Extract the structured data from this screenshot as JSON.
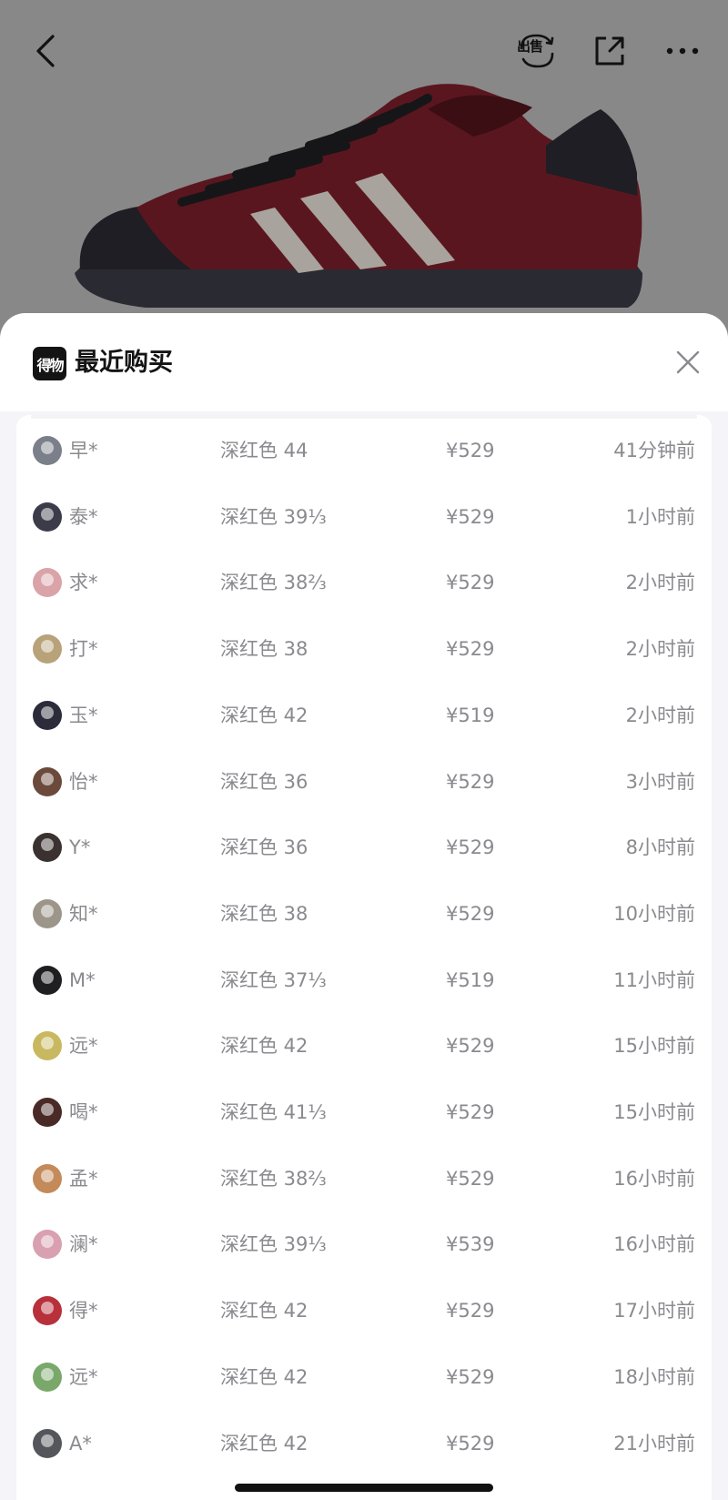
{
  "nav": {
    "back_icon": "chevron-left-icon",
    "sell_label": "出售",
    "share_icon": "share-out-icon",
    "more_icon": "more-horizontal-icon"
  },
  "sheet": {
    "logo_text": "得物",
    "title": "最近购买",
    "close_icon": "close-icon"
  },
  "colors": {
    "overlay_grey": "#888888",
    "shoe_burgundy": "#5a161f",
    "text_primary": "#141414",
    "text_secondary": "#8a8a8f",
    "sheet_background": "#f4f4f9"
  },
  "purchases": [
    {
      "name": "早*",
      "spec": "深红色 44",
      "price": "¥529",
      "time": "41分钟前",
      "avatar_color": "#7a7f8a"
    },
    {
      "name": "泰*",
      "spec": "深红色 39⅓",
      "price": "¥529",
      "time": "1小时前",
      "avatar_color": "#3b3b4a"
    },
    {
      "name": "求*",
      "spec": "深红色 38⅔",
      "price": "¥529",
      "time": "2小时前",
      "avatar_color": "#d9a3a8"
    },
    {
      "name": "打*",
      "spec": "深红色 38",
      "price": "¥529",
      "time": "2小时前",
      "avatar_color": "#b8a27a"
    },
    {
      "name": "玉*",
      "spec": "深红色 42",
      "price": "¥519",
      "time": "2小时前",
      "avatar_color": "#2b2b3a"
    },
    {
      "name": "怡*",
      "spec": "深红色 36",
      "price": "¥529",
      "time": "3小时前",
      "avatar_color": "#6b4a3c"
    },
    {
      "name": "Y*",
      "spec": "深红色 36",
      "price": "¥529",
      "time": "8小时前",
      "avatar_color": "#3a3230"
    },
    {
      "name": "知*",
      "spec": "深红色 38",
      "price": "¥529",
      "time": "10小时前",
      "avatar_color": "#9c968a"
    },
    {
      "name": "M*",
      "spec": "深红色 37⅓",
      "price": "¥519",
      "time": "11小时前",
      "avatar_color": "#1f1f22"
    },
    {
      "name": "远*",
      "spec": "深红色 42",
      "price": "¥529",
      "time": "15小时前",
      "avatar_color": "#c8b860"
    },
    {
      "name": "喝*",
      "spec": "深红色 41⅓",
      "price": "¥529",
      "time": "15小时前",
      "avatar_color": "#4a2a26"
    },
    {
      "name": "孟*",
      "spec": "深红色 38⅔",
      "price": "¥529",
      "time": "16小时前",
      "avatar_color": "#c48a5a"
    },
    {
      "name": "澜*",
      "spec": "深红色 39⅓",
      "price": "¥539",
      "time": "16小时前",
      "avatar_color": "#d8a0b0"
    },
    {
      "name": "得*",
      "spec": "深红色 42",
      "price": "¥529",
      "time": "17小时前",
      "avatar_color": "#b8303a"
    },
    {
      "name": "远*",
      "spec": "深红色 42",
      "price": "¥529",
      "time": "18小时前",
      "avatar_color": "#7aa86a"
    },
    {
      "name": "A*",
      "spec": "深红色 42",
      "price": "¥529",
      "time": "21小时前",
      "avatar_color": "#55565c"
    }
  ]
}
